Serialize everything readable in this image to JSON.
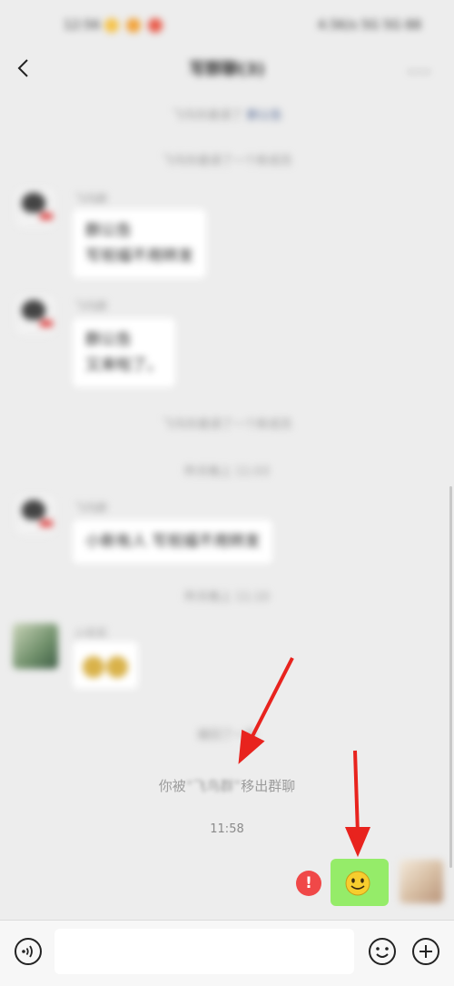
{
  "status_bar": {
    "time": "12:56",
    "right": "4.5K/s 5G 5G 88"
  },
  "nav": {
    "title": "写群聊(3)",
    "more": "···"
  },
  "messages": {
    "sys_invite": "飞鸟你邀请了",
    "sys_invite_link": "群公告",
    "sys_joined_1": "飞鸟你邀请了一个新成员",
    "sender_1": "飞鸟群",
    "bubble_1_line1": "群公告",
    "bubble_1_line2": "写祝福不用转发",
    "sender_2": "飞鸟群",
    "bubble_2_line1": "群公告",
    "bubble_2_line2": "又来啦了。",
    "sys_joined_2": "飞鸟你邀请了一个新成员",
    "sys_time_1": "昨天晚上 11:03",
    "sender_3": "飞鸟群",
    "bubble_3": "小新有人  写祝福不用转发",
    "sys_time_2": "昨天晚上 11:10",
    "sender_4": "小花花",
    "sys_recall": "撤回了一条",
    "notice_prefix": "你被",
    "notice_name": "“飞鸟群”",
    "notice_suffix": "移出群聊",
    "time": "11:58",
    "error_mark": "!"
  },
  "colors": {
    "background": "#ededed",
    "bubble_self": "#95ec69",
    "error": "#f04848",
    "arrow": "#e8231e",
    "link": "#576b95"
  },
  "icons": {
    "back": "back-chevron-icon",
    "voice": "voice-icon",
    "emoji": "emoji-icon",
    "plus": "plus-icon"
  }
}
